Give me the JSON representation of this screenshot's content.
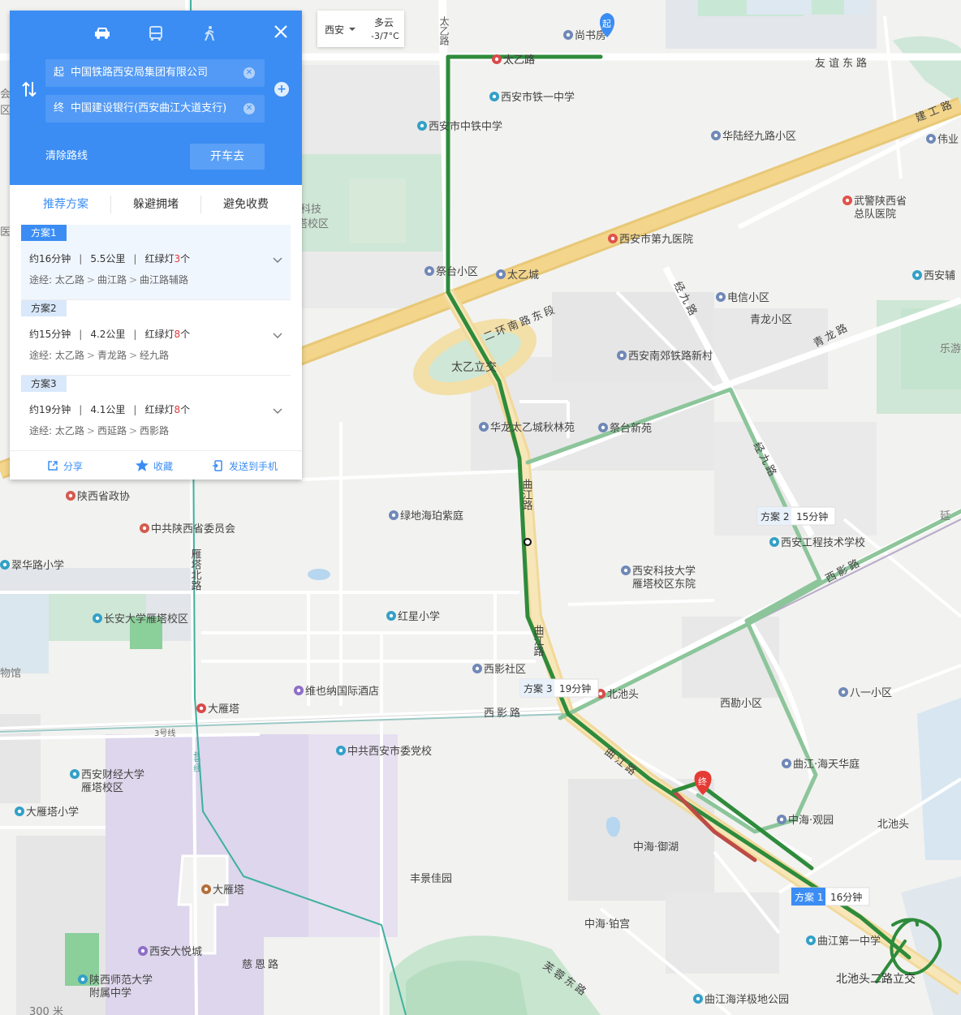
{
  "panel": {
    "modes": [
      {
        "name": "car-icon",
        "active": true
      },
      {
        "name": "bus-icon",
        "active": false
      },
      {
        "name": "walk-icon",
        "active": false
      }
    ],
    "start_tag": "起",
    "start_value": "中国铁路西安局集团有限公司",
    "end_tag": "终",
    "end_value": "中国建设银行(西安曲江大道支行)",
    "clear_route_label": "清除路线",
    "go_label": "开车去",
    "pref_tabs": [
      "推荐方案",
      "躲避拥堵",
      "避免收费"
    ],
    "plans": [
      {
        "tag": "方案1",
        "time": "约16分钟",
        "distance": "5.5公里",
        "lights_label": "红绿灯",
        "lights": "3",
        "lights_unit": "个",
        "via_label": "途经:",
        "via": [
          "太乙路",
          "曲江路",
          "曲江路辅路"
        ]
      },
      {
        "tag": "方案2",
        "time": "约15分钟",
        "distance": "4.2公里",
        "lights_label": "红绿灯",
        "lights": "8",
        "lights_unit": "个",
        "via_label": "途经:",
        "via": [
          "太乙路",
          "青龙路",
          "经九路"
        ]
      },
      {
        "tag": "方案3",
        "time": "约19分钟",
        "distance": "4.1公里",
        "lights_label": "红绿灯",
        "lights": "8",
        "lights_unit": "个",
        "via_label": "途经:",
        "via": [
          "太乙路",
          "西延路",
          "西影路"
        ]
      }
    ],
    "share_label": "分享",
    "favorite_label": "收藏",
    "send_label": "发送到手机"
  },
  "weather": {
    "city": "西安",
    "condition": "多云",
    "temp": "-3/7°C"
  },
  "markers": {
    "start": "起",
    "end": "终"
  },
  "route_labels": {
    "plan1": {
      "name": "方案 1",
      "time": "16分钟"
    },
    "plan2": {
      "name": "方案 2",
      "time": "15分钟"
    },
    "plan3": {
      "name": "方案 3",
      "time": "19分钟"
    }
  },
  "roads": {
    "taiyi_road": "太乙路",
    "taiyi_road_v": "太乙路",
    "youyi_east": "友谊东路",
    "jiangong_road": "建工路",
    "second_ring": "二环南路东段",
    "taiyi_interchange": "太乙立交",
    "jingjiu_1": "经九路",
    "jingjiu_2": "经九路",
    "qinglong_road": "青龙路",
    "qujiang_road_1": "曲江路",
    "qujiang_road_2": "曲江路",
    "qujiang_road_3": "曲江路",
    "xiying_road": "西影路",
    "xiying_road_2": "西影路",
    "yanta_north": "雁塔北路",
    "line3": "3号线",
    "line4": "4号线",
    "ci_en_road": "慈恩路",
    "furong_east": "芙蓉东路",
    "beichitou_interchange": "北池头二路立交"
  },
  "pois": [
    {
      "text": "尚书房",
      "icon": "shop"
    },
    {
      "text": "西安市铁一中学",
      "icon": "school"
    },
    {
      "text": "西安市中铁中学",
      "icon": "school"
    },
    {
      "text": "华陆经九路小区",
      "icon": "house"
    },
    {
      "text": "伟业",
      "icon": "house"
    },
    {
      "text": "武警陕西省",
      "icon": "hospital"
    },
    {
      "text": "总队医院",
      "icon": "none"
    },
    {
      "text": "西安市第九医院",
      "icon": "hospital"
    },
    {
      "text": "祭台小区",
      "icon": "house"
    },
    {
      "text": "太乙城",
      "icon": "house"
    },
    {
      "text": "电信小区",
      "icon": "house"
    },
    {
      "text": "青龙小区",
      "icon": "none"
    },
    {
      "text": "西安辅",
      "icon": "school"
    },
    {
      "text": "西安南郊铁路新村",
      "icon": "house"
    },
    {
      "text": "华龙太乙城秋林苑",
      "icon": "house"
    },
    {
      "text": "祭台新苑",
      "icon": "house"
    },
    {
      "text": "陕西省政协",
      "icon": "gov"
    },
    {
      "text": "中共陕西省委员会",
      "icon": "gov"
    },
    {
      "text": "绿地海珀紫庭",
      "icon": "house"
    },
    {
      "text": "西安工程技术学校",
      "icon": "school"
    },
    {
      "text": "翠华路小学",
      "icon": "school"
    },
    {
      "text": "西安科技大学",
      "icon": "house"
    },
    {
      "text": "雁塔校区东院",
      "icon": "none"
    },
    {
      "text": "长安大学雁塔校区",
      "icon": "edu"
    },
    {
      "text": "红星小学",
      "icon": "school"
    },
    {
      "text": "西影社区",
      "icon": "house"
    },
    {
      "text": "维也纳国际酒店",
      "icon": "hotel"
    },
    {
      "text": "北池头",
      "icon": "metro"
    },
    {
      "text": "西勘小区",
      "icon": "none"
    },
    {
      "text": "八一小区",
      "icon": "house"
    },
    {
      "text": "大雁塔",
      "icon": "metro"
    },
    {
      "text": "中共西安市委党校",
      "icon": "school"
    },
    {
      "text": "西安财经大学",
      "icon": "school"
    },
    {
      "text": "雁塔校区",
      "icon": "none"
    },
    {
      "text": "大雁塔小学",
      "icon": "school"
    },
    {
      "text": "曲江·海天华庭",
      "icon": "house"
    },
    {
      "text": "中海·观园",
      "icon": "house"
    },
    {
      "text": "北池头",
      "icon": "none"
    },
    {
      "text": "中海·御湖",
      "icon": "none"
    },
    {
      "text": "丰景佳园",
      "icon": "none"
    },
    {
      "text": "大雁塔",
      "icon": "scenic"
    },
    {
      "text": "中海·铂宫",
      "icon": "none"
    },
    {
      "text": "曲江第一中学",
      "icon": "school"
    },
    {
      "text": "西安大悦城",
      "icon": "mall"
    },
    {
      "text": "陕西师范大学",
      "icon": "school"
    },
    {
      "text": "附属中学",
      "icon": "none"
    },
    {
      "text": "曲江海洋极地公园",
      "icon": "park"
    },
    {
      "text": "太乙路",
      "icon": "metro"
    },
    {
      "text": "物馆",
      "icon": "none"
    },
    {
      "text": "会",
      "icon": "none"
    },
    {
      "text": "区",
      "icon": "none"
    },
    {
      "text": "医院",
      "icon": "none"
    },
    {
      "text": "乐游",
      "icon": "none"
    },
    {
      "text": "科技",
      "icon": "none"
    },
    {
      "text": "塔校区",
      "icon": "none"
    },
    {
      "text": "延",
      "icon": "none"
    },
    {
      "text": "300 米",
      "icon": "none"
    }
  ]
}
